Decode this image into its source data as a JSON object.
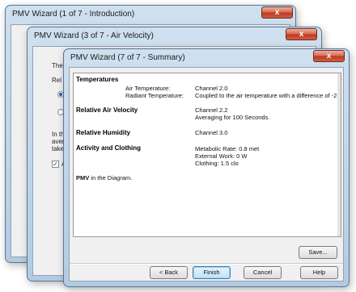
{
  "windows": {
    "back": {
      "title": "PMV Wizard (1 of 7 - Introduction)",
      "close_glyph": "x"
    },
    "middle": {
      "title": "PMV Wizard (3 of 7 - Air Velocity)",
      "close_glyph": "x",
      "peek": {
        "line1": "The",
        "line2": "Rel",
        "para1": "In th",
        "para2": "aver",
        "para3": "take",
        "checkbox_label": "A"
      }
    },
    "front": {
      "title": "PMV Wizard (7 of 7 - Summary)",
      "close_glyph": "x",
      "summary": {
        "temperatures": {
          "heading": "Temperatures",
          "air_label": "Air Temperature:",
          "air_value": "Channel 2.0",
          "radiant_label": "Radiant Temperature:",
          "radiant_value": "Coupled to the air temperature with a difference of -2"
        },
        "air_velocity": {
          "heading": "Relative Air Velocity",
          "line1": "Channel 2.2",
          "line2": "Averaging for 100 Seconds."
        },
        "humidity": {
          "heading": "Relative Humidity",
          "value": "Channel 3.0"
        },
        "activity": {
          "heading": "Activity and Clothing",
          "line1": "Metabolic Rate: 0.8 met",
          "line2": "External Work: 0 W",
          "line3": "Clothing: 1.5 clo"
        },
        "pmv": {
          "bold": "PMV",
          "rest": " in the Diagram."
        }
      },
      "buttons": {
        "save": "Save...",
        "back": "< Back",
        "finish": "Finish",
        "cancel": "Cancel",
        "help": "Help"
      }
    }
  }
}
